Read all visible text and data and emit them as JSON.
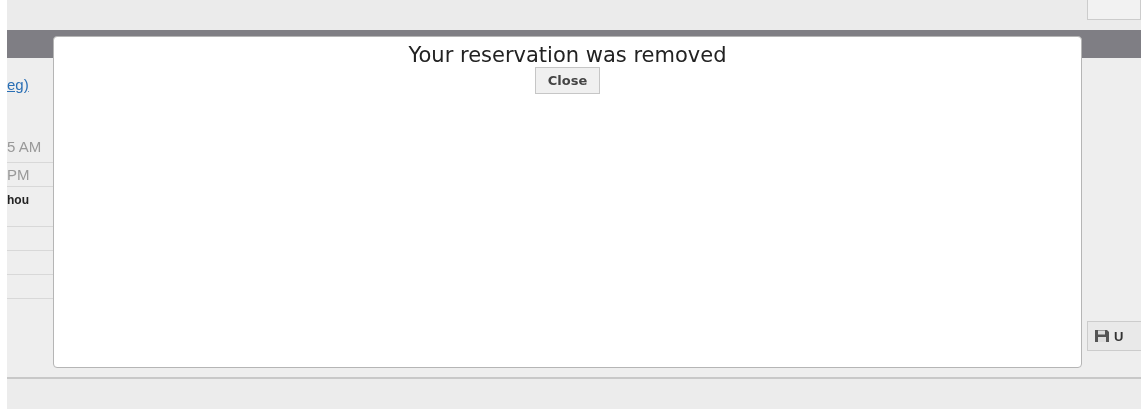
{
  "background": {
    "link": "eg)",
    "times": [
      "5 AM",
      "PM"
    ],
    "note": "hou",
    "button": "U"
  },
  "dialog": {
    "message": "Your reservation was removed",
    "button": "Close"
  }
}
